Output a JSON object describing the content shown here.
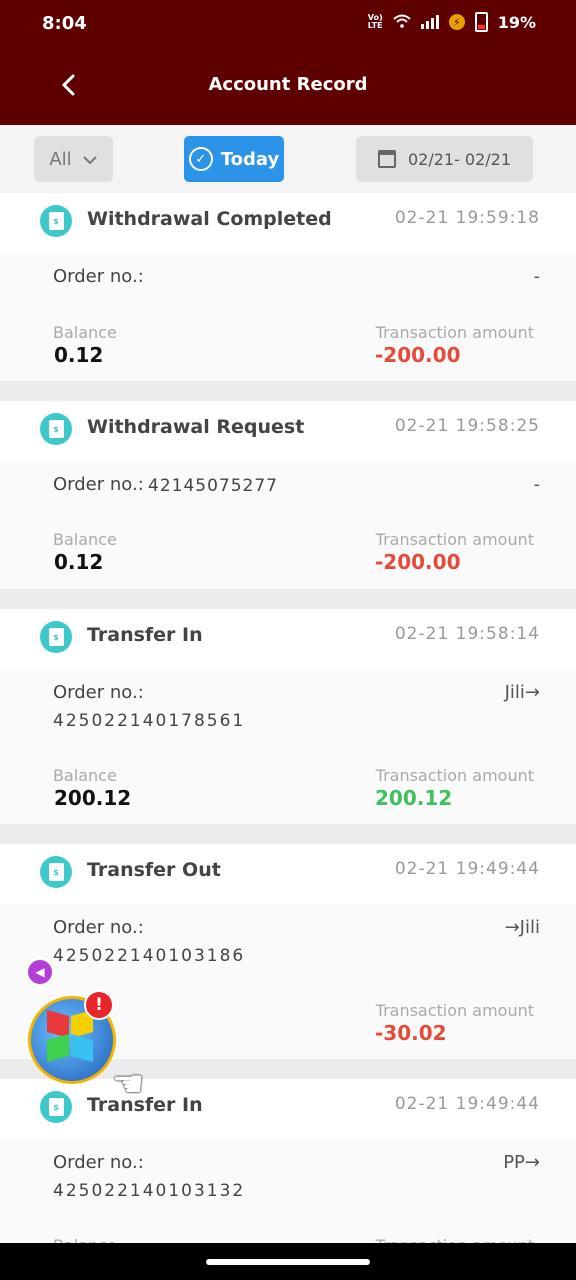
{
  "status": {
    "time": "8:04",
    "network": "VoLTE",
    "battery": "19%"
  },
  "header": {
    "title": "Account Record"
  },
  "filters": {
    "type_label": "All",
    "today_label": "Today",
    "date_range": "02/21- 02/21"
  },
  "labels": {
    "order_no": "Order no.:",
    "balance": "Balance",
    "transaction_amount": "Transaction amount"
  },
  "records": [
    {
      "title": "Withdrawal Completed",
      "time": "02-21 19:59:18",
      "order_no": "",
      "order_right": "-",
      "balance": "0.12",
      "amount": "-200.00",
      "amount_color": "#e44b39"
    },
    {
      "title": "Withdrawal Request",
      "time": "02-21 19:58:25",
      "order_no": "42145075277",
      "order_right": "-",
      "balance": "0.12",
      "amount": "-200.00",
      "amount_color": "#e44b39"
    },
    {
      "title": "Transfer In",
      "time": "02-21 19:58:14",
      "order_no": "425022140178561",
      "order_right": "Jili→",
      "balance": "200.12",
      "amount": "200.12",
      "amount_color": "#3fc05c"
    },
    {
      "title": "Transfer Out",
      "time": "02-21 19:49:44",
      "order_no": "425022140103186",
      "order_right": "→Jili",
      "balance": "",
      "amount": "-30.02",
      "amount_color": "#e44b39"
    },
    {
      "title": "Transfer In",
      "time": "02-21 19:49:44",
      "order_no": "425022140103132",
      "order_right": "PP→",
      "balance": "",
      "amount": "",
      "amount_color": "#3fc05c"
    }
  ],
  "icons": {
    "back": "chevron-left-icon",
    "record": "receipt-icon",
    "calendar": "calendar-icon",
    "check": "check-circle-icon",
    "dropdown": "chevron-down-icon"
  }
}
